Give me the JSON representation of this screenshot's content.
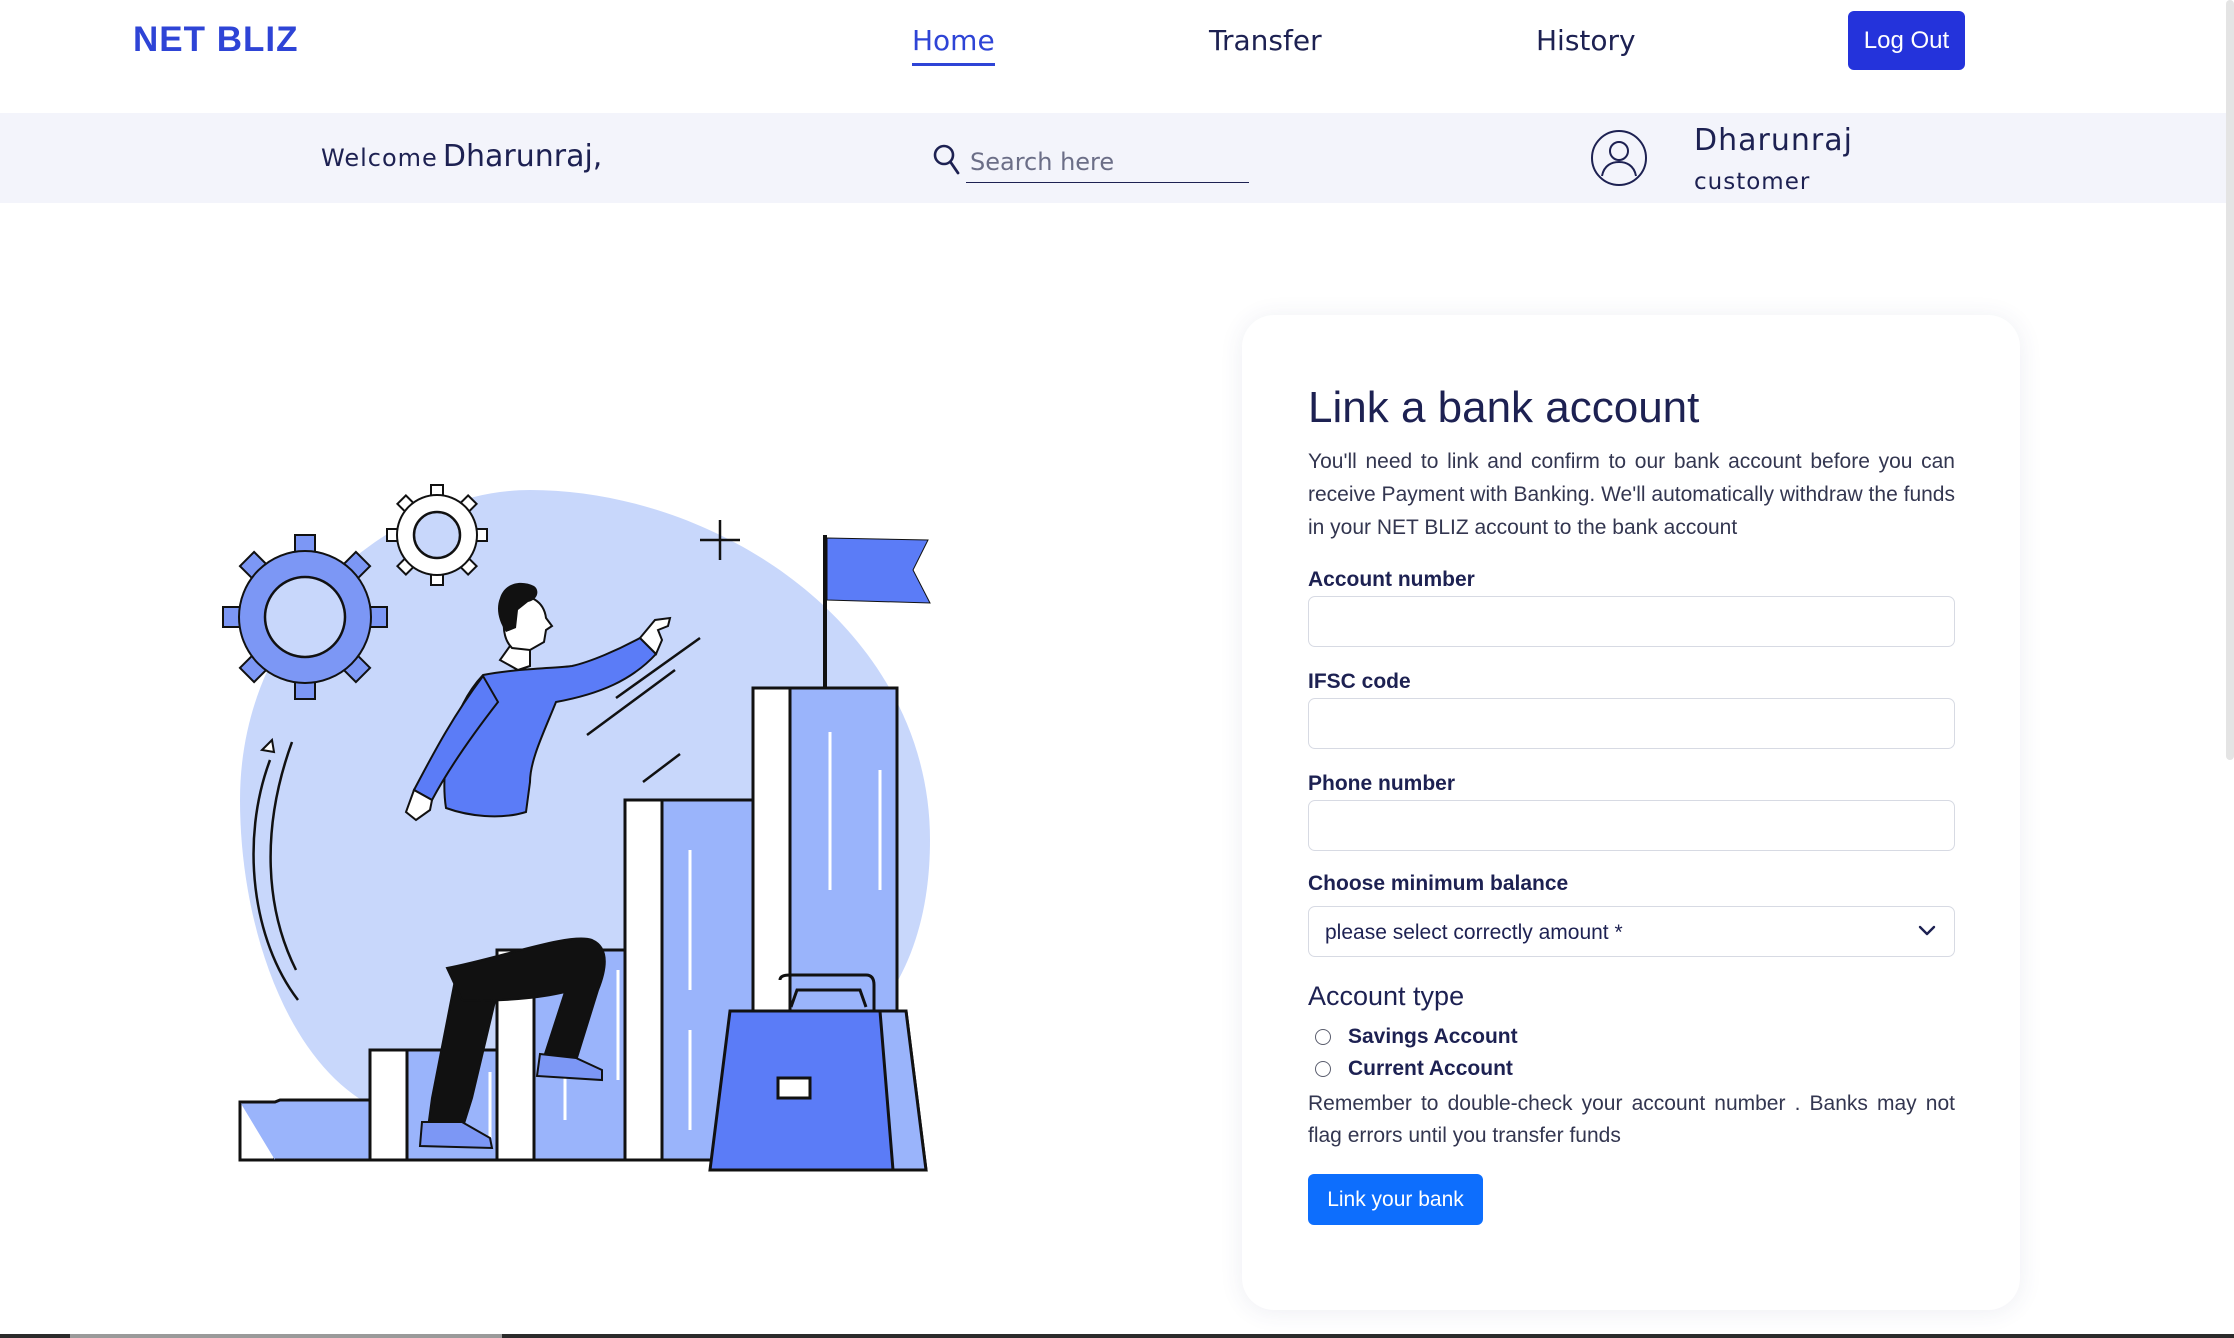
{
  "navbar": {
    "brand": "NET BLIZ",
    "links": [
      {
        "label": "Home",
        "active": true
      },
      {
        "label": "Transfer",
        "active": false
      },
      {
        "label": "History",
        "active": false
      }
    ],
    "logout_label": "Log Out"
  },
  "welcome_bar": {
    "welcome_word": "Welcome",
    "welcome_name": "Dharunraj,",
    "search_placeholder": "Search here",
    "search_icon": "search-icon",
    "avatar_icon": "user-avatar-icon",
    "user_name": "Dharunraj",
    "user_role": "customer"
  },
  "illustration": {
    "subject": "person-climbing-bar-chart-illustration"
  },
  "form": {
    "title": "Link a bank account",
    "description": "You'll need to link and confirm to our bank account before you can receive Payment with Banking. We'll automatically withdraw the funds in your NET BLIZ account to the bank account",
    "fields": [
      {
        "label": "Account number",
        "value": "",
        "placeholder": ""
      },
      {
        "label": "IFSC code",
        "value": "",
        "placeholder": ""
      },
      {
        "label": "Phone number",
        "value": "",
        "placeholder": ""
      }
    ],
    "balance_label": "Choose minimum balance",
    "balance_selected": "please select correctly amount *",
    "account_type_title": "Account type",
    "account_types": [
      {
        "label": "Savings Account",
        "checked": false
      },
      {
        "label": "Current Account",
        "checked": false
      }
    ],
    "note": "Remember to double-check your account number . Banks may not flag errors until you transfer funds",
    "submit_label": "Link your bank"
  },
  "colors": {
    "brand": "#2e44d6",
    "logout": "#2433db",
    "primary_button": "#0d6efd",
    "text": "#1d2152",
    "welcome_bar_bg": "#f3f4fb",
    "illustration_blue": "#5b7cf7",
    "illustration_light": "#c8d7fb"
  }
}
